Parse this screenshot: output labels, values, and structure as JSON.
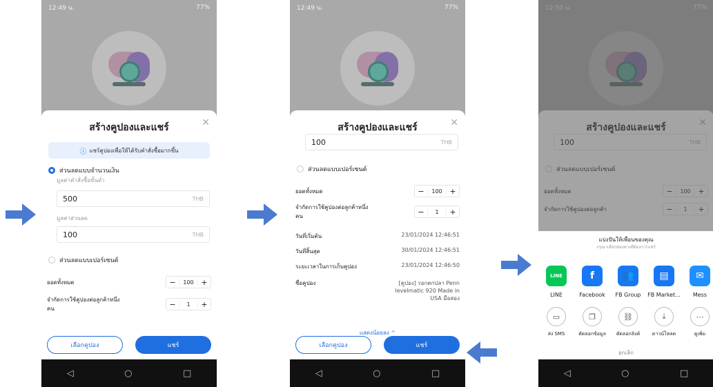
{
  "common": {
    "nav": {
      "back": "◁",
      "home": "○",
      "recents": "□"
    },
    "colors": {
      "accent": "#1f6fe0",
      "arrow": "#4a7bd0"
    }
  },
  "screen1": {
    "status_time": "12:49 น.",
    "status_right": "77%",
    "title": "สร้างคูปองและแชร์",
    "banner": "แชร์คูปองเพื่อให้ได้รับคำสั่งซื้อมากขึ้น",
    "option_amount": "ส่วนลดแบบจำนวนเงิน",
    "min_order_label": "มูลค่าคำสั่งซื้อขั้นต่ำ",
    "min_order_value": "500",
    "discount_label": "มูลค่าส่วนลด",
    "discount_value": "100",
    "unit": "THB",
    "option_percent": "ส่วนลดแบบเปอร์เซนต์",
    "total_label": "ยอดทั้งหมด",
    "total_value": "100",
    "limit_label": "จำกัดการใช้คูปองต่อลูกค้าหนึ่งคน",
    "limit_value": "1",
    "select_btn": "เลือกคูปอง",
    "share_btn": "แชร์"
  },
  "screen2": {
    "status_time": "12:49 น.",
    "status_right": "77%",
    "title": "สร้างคูปองและแชร์",
    "discount_value": "100",
    "unit": "THB",
    "option_percent": "ส่วนลดแบบเปอร์เซนต์",
    "total_label": "ยอดทั้งหมด",
    "total_value": "100",
    "limit_label": "จำกัดการใช้คูปองต่อลูกค้าหนึ่งคน",
    "limit_value": "1",
    "start_label": "วันที่เริ่มต้น",
    "start_value": "23/01/2024 12:46:51",
    "end_label": "วันที่สิ้นสุด",
    "end_value": "30/01/2024 12:46:51",
    "collect_label": "ระยะเวลาในการเก็บคูปอง",
    "collect_value": "23/01/2024 12:46:50",
    "name_label": "ชื่อคูปอง",
    "name_value": "[คูปอง] รอกตกปลา Penn levelmatic 920 Made in USA มือสอง",
    "show_less": "แสดงน้อยลง ^",
    "select_btn": "เลือกคูปอง",
    "share_btn": "แชร์"
  },
  "screen3": {
    "status_time": "12:50 น.",
    "status_right": "77%",
    "title": "สร้างคูปองและแชร์",
    "discount_value": "100",
    "unit": "THB",
    "option_percent": "ส่วนลดแบบเปอร์เซนต์",
    "total_label": "ยอดทั้งหมด",
    "total_value": "100",
    "limit_label": "จำกัดการใช้คูปองต่อลูกค้า",
    "limit_value": "1",
    "share_title": "แบ่งปันให้เพื่อนของคุณ",
    "share_sub": "กรุณาเลือกช่องทางที่ต้องการแชร์",
    "apps": [
      {
        "label": "LINE",
        "icon": "line-icon",
        "color": "#06c755",
        "glyph": "LINE"
      },
      {
        "label": "Facebook",
        "icon": "facebook-icon",
        "color": "#1877f2",
        "glyph": "f"
      },
      {
        "label": "FB Group",
        "icon": "fb-group-icon",
        "color": "#1877f2",
        "glyph": "👥"
      },
      {
        "label": "FB Market...",
        "icon": "fb-marketplace-icon",
        "color": "#1877f2",
        "glyph": "▤"
      },
      {
        "label": "Mess",
        "icon": "messenger-icon",
        "color": "#1e90ff",
        "glyph": "✉"
      }
    ],
    "tools": [
      {
        "label": "ส่ง SMS",
        "icon": "sms-icon",
        "glyph": "▭"
      },
      {
        "label": "คัดลอกข้อมูล",
        "icon": "copy-info-icon",
        "glyph": "❐"
      },
      {
        "label": "คัดลอกลิงค์",
        "icon": "link-icon",
        "glyph": "⛓"
      },
      {
        "label": "ดาวน์โหลด",
        "icon": "download-icon",
        "glyph": "⤓"
      },
      {
        "label": "ดูเพิ่ม",
        "icon": "more-icon",
        "glyph": "⋯"
      }
    ],
    "cancel": "ยกเลิก"
  }
}
